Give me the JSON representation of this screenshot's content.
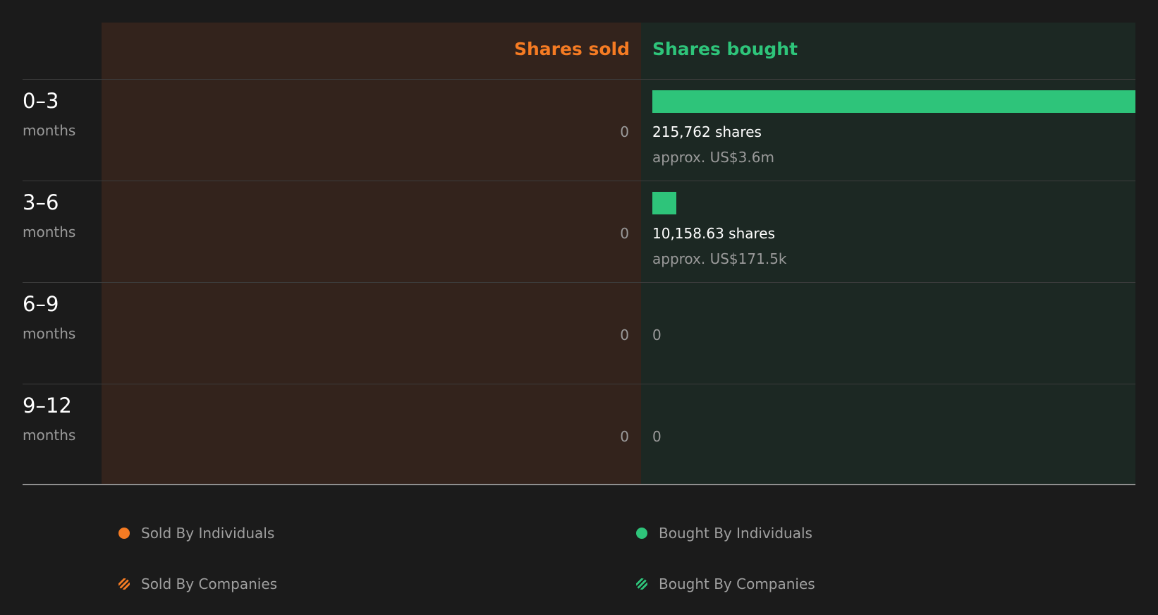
{
  "colors": {
    "sold": "#f57b23",
    "bought": "#2ec47a",
    "sold_panel": "#33231c",
    "bought_panel": "#1c2823",
    "background": "#1b1b1b"
  },
  "chart_data": {
    "type": "bar",
    "orientation": "horizontal-diverging",
    "headers": {
      "sold": "Shares sold",
      "bought": "Shares bought"
    },
    "unit_label": "months",
    "rows": [
      {
        "range": "0–3",
        "unit": "months",
        "sold_value": 0,
        "sold_text": "0",
        "bought_value": 215762,
        "bought_text": "215,762 shares",
        "bought_approx": "approx. US$3.6m"
      },
      {
        "range": "3–6",
        "unit": "months",
        "sold_value": 0,
        "sold_text": "0",
        "bought_value": 10158.63,
        "bought_text": "10,158.63 shares",
        "bought_approx": "approx. US$171.5k"
      },
      {
        "range": "6–9",
        "unit": "months",
        "sold_value": 0,
        "sold_text": "0",
        "bought_value": 0,
        "bought_text": "0",
        "bought_approx": ""
      },
      {
        "range": "9–12",
        "unit": "months",
        "sold_value": 0,
        "sold_text": "0",
        "bought_value": 0,
        "bought_text": "0",
        "bought_approx": ""
      }
    ],
    "legend": [
      {
        "label": "Sold By Individuals",
        "color": "#f57b23",
        "pattern": "solid"
      },
      {
        "label": "Bought By Individuals",
        "color": "#2ec47a",
        "pattern": "solid"
      },
      {
        "label": "Sold By Companies",
        "color": "#f57b23",
        "pattern": "hatched"
      },
      {
        "label": "Bought By Companies",
        "color": "#2ec47a",
        "pattern": "hatched"
      }
    ]
  }
}
